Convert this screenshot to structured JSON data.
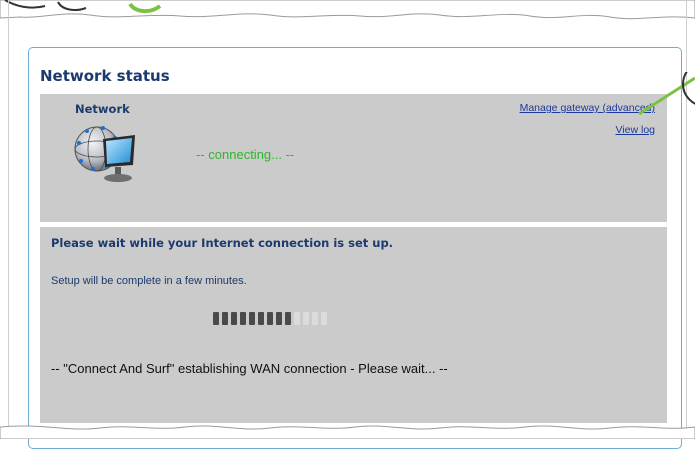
{
  "network_status": {
    "section_title": "Network status",
    "heading": "Network",
    "icon": "network-computer-icon",
    "status_text": "-- connecting... --",
    "links": {
      "manage_gateway": "Manage gateway (advanced)",
      "view_log": "View log"
    }
  },
  "setup": {
    "heading": "Please wait while your Internet connection is set up.",
    "subtext": "Setup will be complete in a few minutes.",
    "progress": {
      "filled_segments": 9,
      "total_segments": 13,
      "fraction": 0.69
    },
    "wan_status": "-- \"Connect And Surf\" establishing WAN connection - Please wait... --"
  },
  "colors": {
    "frame_border": "#6aaed6",
    "panel_bg": "#cbcbcb",
    "heading": "#1c3a6e",
    "status_green": "#2fb52f",
    "link": "#1a3aa0",
    "callout_green": "#7cc242"
  }
}
